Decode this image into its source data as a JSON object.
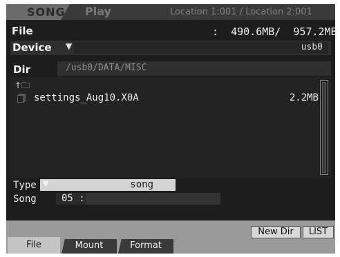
{
  "header": {
    "mode_label": "SONG",
    "sub_label": "Play",
    "location": "Location 1:001 / Location 2:001"
  },
  "file_bar": {
    "label": "File",
    "size_info": ":  490.6MB/  957.2MB"
  },
  "device": {
    "label": "Device",
    "value": "usb0"
  },
  "dir": {
    "label": "Dir",
    "value": "/usb0/DATA/MISC"
  },
  "file_list": {
    "up_icon": "up-folder-icon",
    "items": [
      {
        "name": "settings_Aug10.X0A",
        "size": "2.2MB",
        "icon": "file-icon"
      }
    ]
  },
  "type": {
    "label": "Type",
    "value": "song"
  },
  "song": {
    "label": "Song",
    "number": "05 :",
    "name": ""
  },
  "buttons": {
    "new_dir": "New Dir",
    "list": "LIST"
  },
  "tabs": [
    {
      "label": "File",
      "active": true
    },
    {
      "label": "Mount",
      "active": false
    },
    {
      "label": "Format",
      "active": false
    }
  ]
}
